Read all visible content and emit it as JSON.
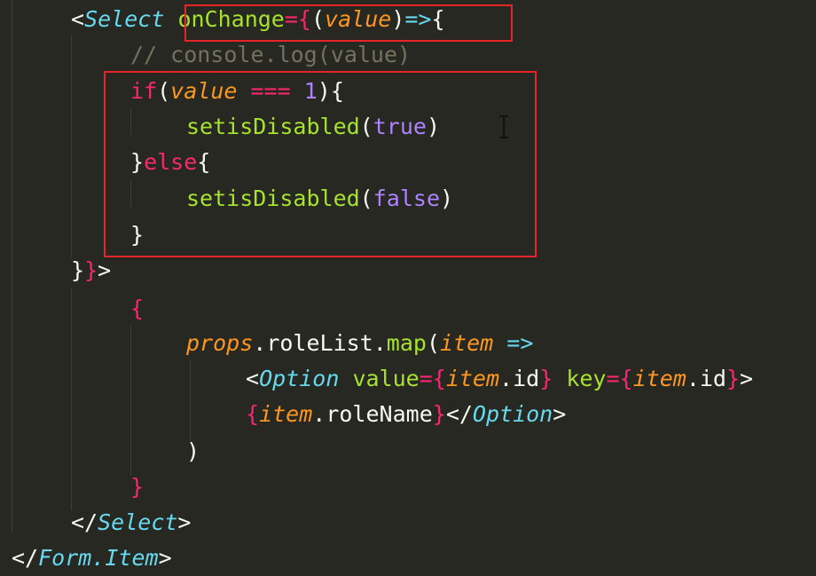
{
  "colors": {
    "background": "#272822",
    "default": "#f8f8f2",
    "punct": "#f8f8f2",
    "tag": "#66d9ef",
    "attr": "#a6e22e",
    "keyword": "#f92672",
    "param": "#fd971f",
    "number": "#ae81ff",
    "comment": "#75715e",
    "highlight_box": "#e8242b"
  },
  "lines": [
    [
      [
        "<",
        "punct"
      ],
      [
        "Select",
        "tag",
        true
      ],
      [
        " ",
        "default"
      ],
      [
        "onChange",
        "attr"
      ],
      [
        "=",
        "keyword"
      ],
      [
        "{",
        "keyword"
      ],
      [
        "(",
        "punct"
      ],
      [
        "value",
        "param",
        true
      ],
      [
        ")",
        "punct"
      ],
      [
        "=>",
        "tag"
      ],
      [
        "{",
        "punct"
      ]
    ],
    [
      [
        "// console.log(value)",
        "comment"
      ]
    ],
    [
      [
        "if",
        "keyword"
      ],
      [
        "(",
        "punct"
      ],
      [
        "value",
        "param",
        true
      ],
      [
        " ",
        "default"
      ],
      [
        "===",
        "keyword"
      ],
      [
        " ",
        "default"
      ],
      [
        "1",
        "number"
      ],
      [
        ")",
        "punct"
      ],
      [
        "{",
        "punct"
      ]
    ],
    [
      [
        "setisDisabled",
        "attr"
      ],
      [
        "(",
        "punct"
      ],
      [
        "true",
        "number"
      ],
      [
        ")",
        "punct"
      ]
    ],
    [
      [
        "}",
        "punct"
      ],
      [
        "else",
        "keyword"
      ],
      [
        "{",
        "punct"
      ]
    ],
    [
      [
        "setisDisabled",
        "attr"
      ],
      [
        "(",
        "punct"
      ],
      [
        "false",
        "number"
      ],
      [
        ")",
        "punct"
      ]
    ],
    [
      [
        "}",
        "punct"
      ]
    ],
    [
      [
        "}",
        "punct"
      ],
      [
        "}",
        "keyword"
      ],
      [
        ">",
        "punct"
      ]
    ],
    [
      [
        "{",
        "keyword"
      ]
    ],
    [
      [
        "props",
        "param",
        true
      ],
      [
        ".roleList.",
        "default"
      ],
      [
        "map",
        "attr"
      ],
      [
        "(",
        "punct"
      ],
      [
        "item",
        "param",
        true
      ],
      [
        " ",
        "default"
      ],
      [
        "=>",
        "tag"
      ]
    ],
    [
      [
        "<",
        "punct"
      ],
      [
        "Option",
        "tag",
        true
      ],
      [
        " ",
        "default"
      ],
      [
        "value",
        "attr"
      ],
      [
        "=",
        "keyword"
      ],
      [
        "{",
        "keyword"
      ],
      [
        "item",
        "param",
        true
      ],
      [
        ".id",
        "default"
      ],
      [
        "}",
        "keyword"
      ],
      [
        " ",
        "default"
      ],
      [
        "key",
        "attr"
      ],
      [
        "=",
        "keyword"
      ],
      [
        "{",
        "keyword"
      ],
      [
        "item",
        "param",
        true
      ],
      [
        ".id",
        "default"
      ],
      [
        "}",
        "keyword"
      ],
      [
        ">",
        "punct"
      ]
    ],
    [
      [
        "{",
        "keyword"
      ],
      [
        "item",
        "param",
        true
      ],
      [
        ".roleName",
        "default"
      ],
      [
        "}",
        "keyword"
      ],
      [
        "</",
        "punct"
      ],
      [
        "Option",
        "tag",
        true
      ],
      [
        ">",
        "punct"
      ]
    ],
    [
      [
        ")",
        "punct"
      ]
    ],
    [
      [
        "}",
        "keyword"
      ]
    ],
    [
      [
        "</",
        "punct"
      ],
      [
        "Select",
        "tag",
        true
      ],
      [
        ">",
        "punct"
      ]
    ],
    [
      [
        "</",
        "punct"
      ],
      [
        "Form.Item",
        "tag",
        true
      ],
      [
        ">",
        "punct"
      ]
    ]
  ]
}
